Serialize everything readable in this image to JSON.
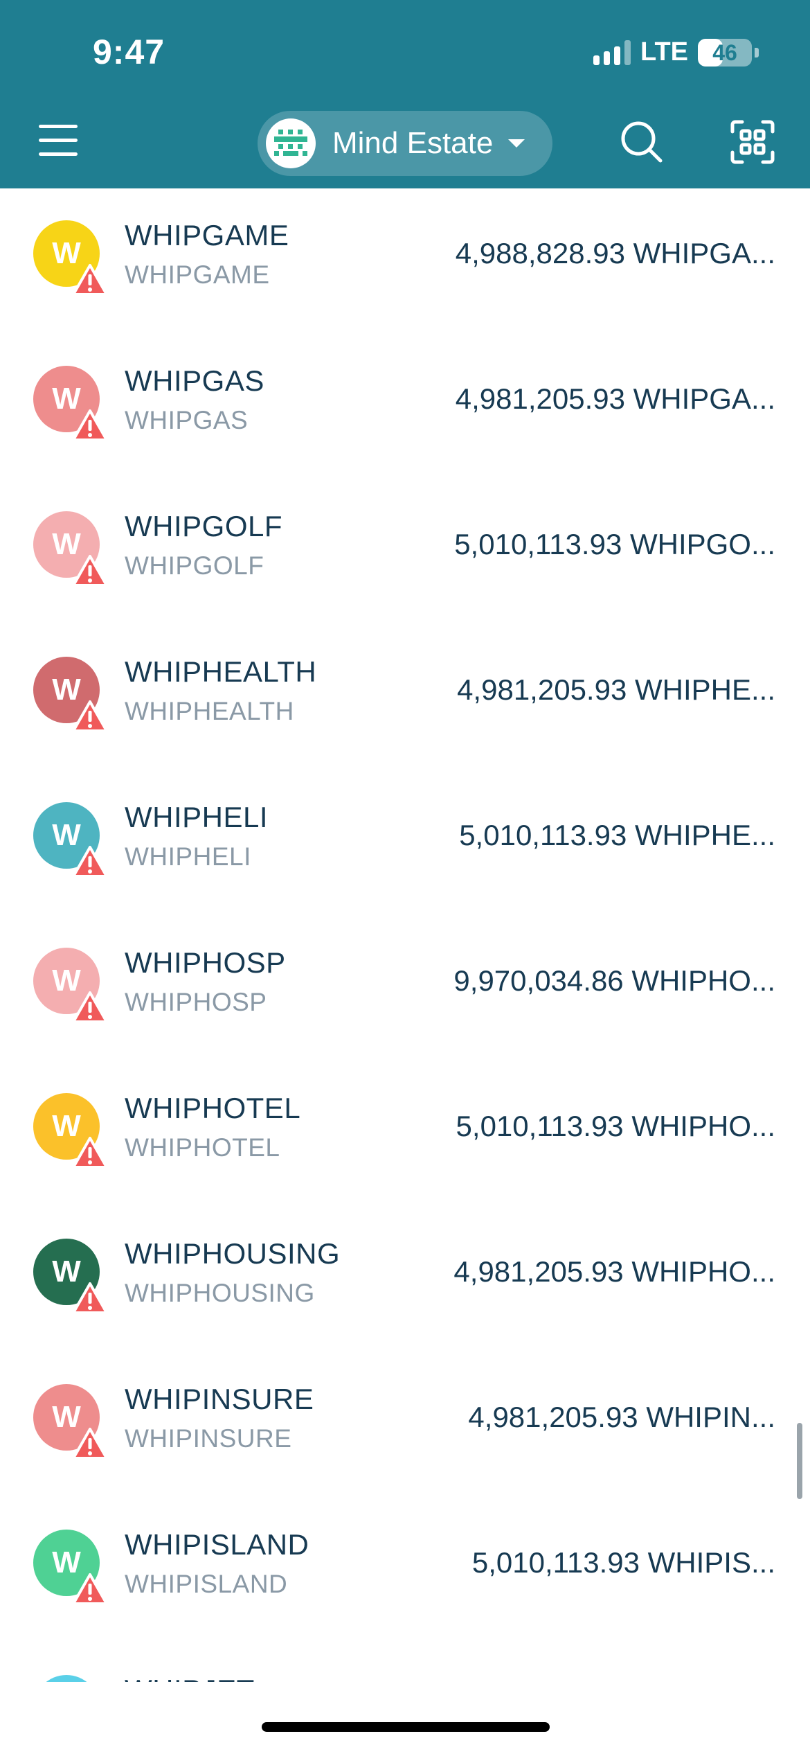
{
  "status_bar": {
    "time": "9:47",
    "network": "LTE",
    "battery": "46",
    "battery_level": 0.46
  },
  "header": {
    "menu_icon": "hamburger-menu-icon",
    "account_name": "Mind Estate",
    "account_icon": "identicon-avatar",
    "search_icon": "search-icon",
    "scan_icon": "qr-scan-icon",
    "background": "#1f7e91"
  },
  "tokens": [
    {
      "letter": "W",
      "name": "WHIPGAME",
      "symbol": "WHIPGAME",
      "balance": "4,988,828.93 WHIPGA...",
      "color": "#f7d417"
    },
    {
      "letter": "W",
      "name": "WHIPGAS",
      "symbol": "WHIPGAS",
      "balance": "4,981,205.93 WHIPGA...",
      "color": "#ee8d8d"
    },
    {
      "letter": "W",
      "name": "WHIPGOLF",
      "symbol": "WHIPGOLF",
      "balance": "5,010,113.93 WHIPGO...",
      "color": "#f4aeb0"
    },
    {
      "letter": "W",
      "name": "WHIPHEALTH",
      "symbol": "WHIPHEALTH",
      "balance": "4,981,205.93 WHIPHE...",
      "color": "#d06b6e"
    },
    {
      "letter": "W",
      "name": "WHIPHELI",
      "symbol": "WHIPHELI",
      "balance": "5,010,113.93 WHIPHE...",
      "color": "#4eb4c1"
    },
    {
      "letter": "W",
      "name": "WHIPHOSP",
      "symbol": "WHIPHOSP",
      "balance": "9,970,034.86 WHIPHO...",
      "color": "#f4aeb0"
    },
    {
      "letter": "W",
      "name": "WHIPHOTEL",
      "symbol": "WHIPHOTEL",
      "balance": "5,010,113.93 WHIPHO...",
      "color": "#fbc12a"
    },
    {
      "letter": "W",
      "name": "WHIPHOUSING",
      "symbol": "WHIPHOUSING",
      "balance": "4,981,205.93 WHIPHO...",
      "color": "#256e50"
    },
    {
      "letter": "W",
      "name": "WHIPINSURE",
      "symbol": "WHIPINSURE",
      "balance": "4,981,205.93 WHIPIN...",
      "color": "#ee8d8d"
    },
    {
      "letter": "W",
      "name": "WHIPISLAND",
      "symbol": "WHIPISLAND",
      "balance": "5,010,113.93 WHIPIS...",
      "color": "#4fd194"
    },
    {
      "letter": "W",
      "name": "WHIPJET",
      "symbol": "",
      "balance": "",
      "color": "#5ad0e8"
    }
  ],
  "colors": {
    "text_primary": "#173a52",
    "text_secondary": "#8a99a6",
    "warning": "#f05a5a"
  }
}
